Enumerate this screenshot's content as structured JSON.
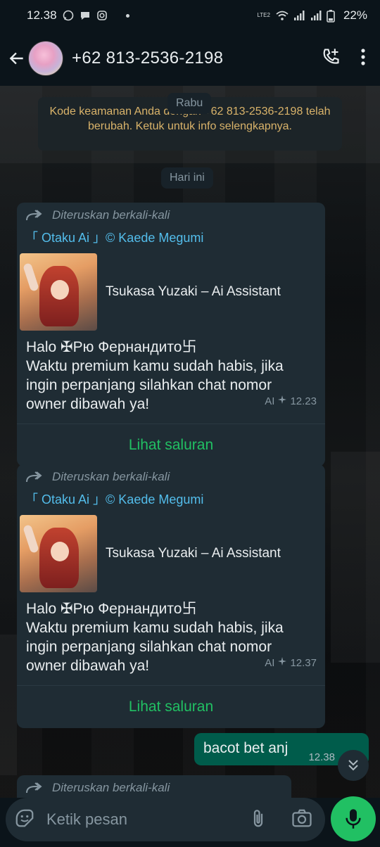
{
  "status_bar": {
    "time": "12.38",
    "battery": "22%",
    "network_label": "LTE2"
  },
  "header": {
    "title": "+62 813-2536-2198"
  },
  "chat": {
    "date_pill_old": "Rabu",
    "security_notice": "Kode keamanan Anda dengan +62 813-2536-2198 telah berubah. Ketuk untuk info selengkapnya.",
    "date_pill_today": "Hari ini",
    "messages": [
      {
        "forward_label": "Diteruskan berkali-kali",
        "channel": "「 Otaku Ai 」© Kaede Megumi",
        "preview_title": "Tsukasa Yuzaki  –  Ai Assistant",
        "body_line1": "Halo ✠Рю Фернандито卐",
        "body_line2": "Waktu premium kamu sudah habis, jika ingin perpanjang silahkan chat nomor owner dibawah ya!",
        "ai_tag": "AI",
        "time": "12.23",
        "action": "Lihat saluran"
      },
      {
        "forward_label": "Diteruskan berkali-kali",
        "channel": "「 Otaku Ai 」© Kaede Megumi",
        "preview_title": "Tsukasa Yuzaki  –  Ai Assistant",
        "body_line1": "Halo ✠Рю Фернандито卐",
        "body_line2": "Waktu premium kamu sudah habis, jika ingin perpanjang silahkan chat nomor owner dibawah ya!",
        "ai_tag": "AI",
        "time": "12.37",
        "action": "Lihat saluran"
      }
    ],
    "outgoing": {
      "text": "bacot bet anj",
      "time": "12.38"
    },
    "partial_forward_label": "Diteruskan berkali-kali"
  },
  "composer": {
    "placeholder": "Ketik pesan"
  },
  "colors": {
    "accent_green": "#21c063",
    "incoming_bubble": "#1f2c34",
    "outgoing_bubble": "#005c4b",
    "channel_blue": "#53bdeb",
    "security_text": "#d9b36a"
  },
  "icons": [
    "whatsapp-icon",
    "chat-icon",
    "instagram-icon",
    "wifi-icon",
    "signal-icon",
    "battery-icon",
    "back-arrow-icon",
    "add-call-icon",
    "more-vert-icon",
    "forward-icon",
    "sparkle-icon",
    "chevron-down-icon",
    "emoji-icon",
    "attach-icon",
    "camera-icon",
    "mic-icon"
  ]
}
